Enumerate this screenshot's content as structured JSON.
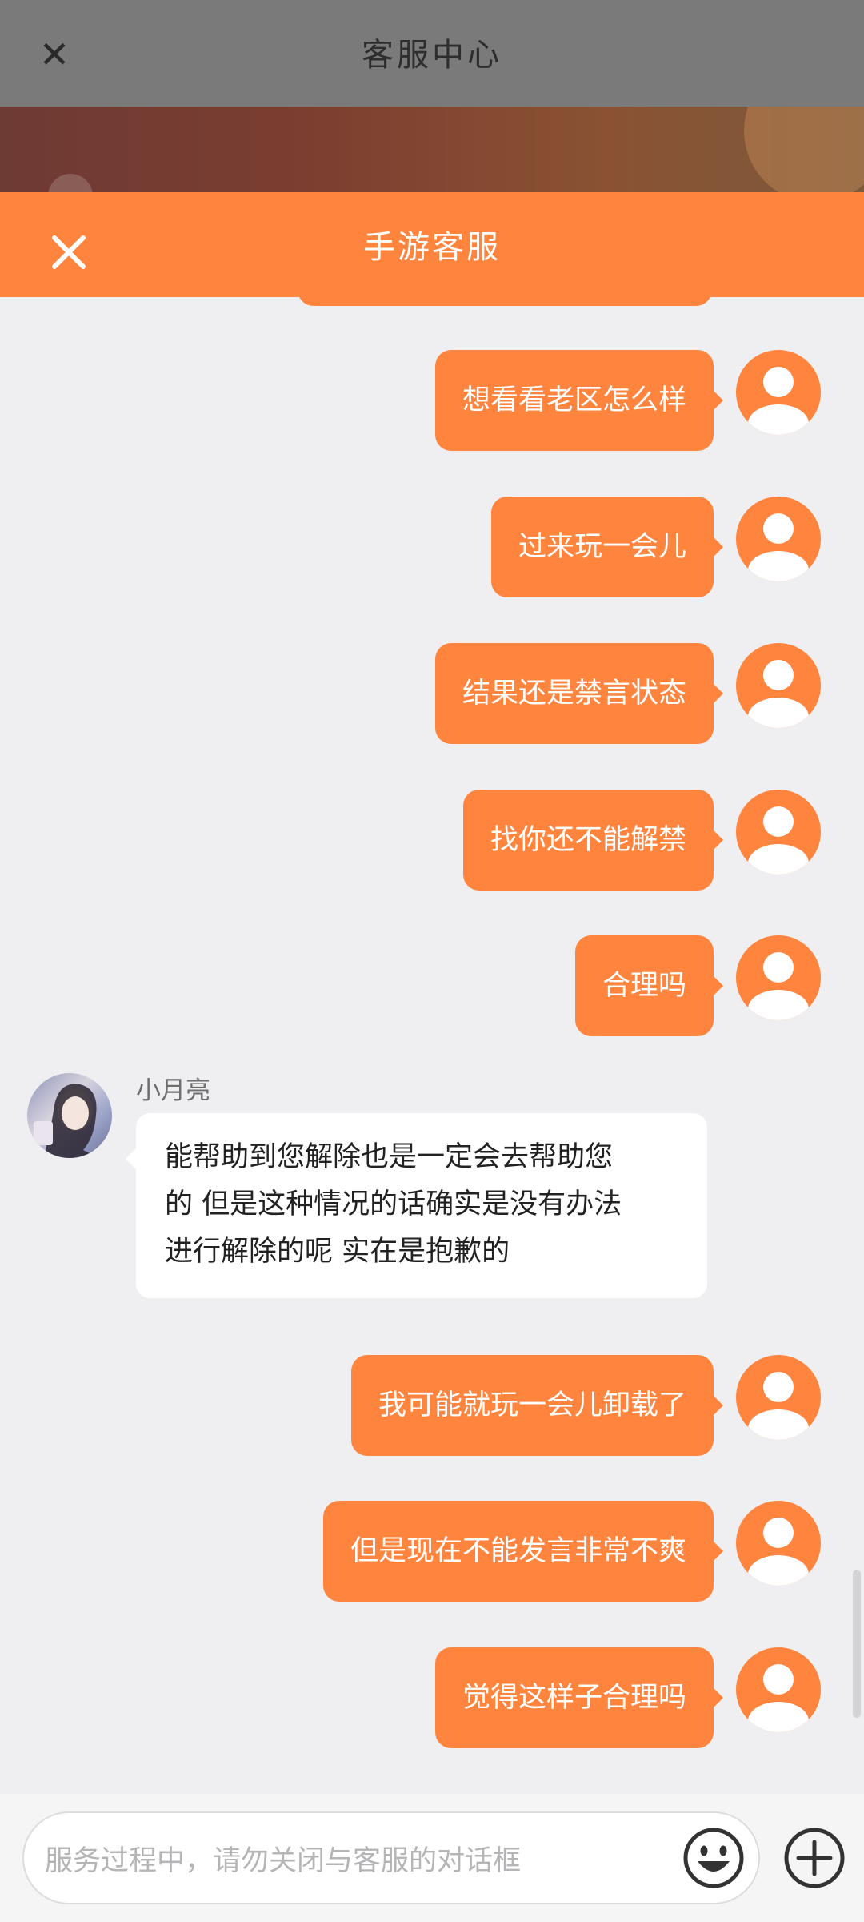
{
  "background_page": {
    "title": "客服中心",
    "close_icon": "close-icon"
  },
  "chat": {
    "title": "手游客服",
    "close_icon": "close-icon",
    "accent_color": "#ff843d"
  },
  "messages_top": [
    {
      "text": "想看看老区怎么样"
    },
    {
      "text": "过来玩一会儿"
    },
    {
      "text": "结果还是禁言状态"
    },
    {
      "text": "找你还不能解禁"
    },
    {
      "text": "合理吗"
    }
  ],
  "agent_message": {
    "name": "小月亮",
    "lines": [
      "能帮助到您解除也是一定会去帮助您",
      "的 但是这种情况的话确实是没有办法",
      "进行解除的呢 实在是抱歉的"
    ]
  },
  "messages_bottom": [
    {
      "text": "我可能就玩一会儿卸载了"
    },
    {
      "text": "但是现在不能发言非常不爽"
    },
    {
      "text": "觉得这样子合理吗"
    }
  ],
  "input": {
    "placeholder": "服务过程中，请勿关闭与客服的对话框",
    "emoji_icon": "emoji-icon",
    "add_icon": "plus-icon"
  }
}
